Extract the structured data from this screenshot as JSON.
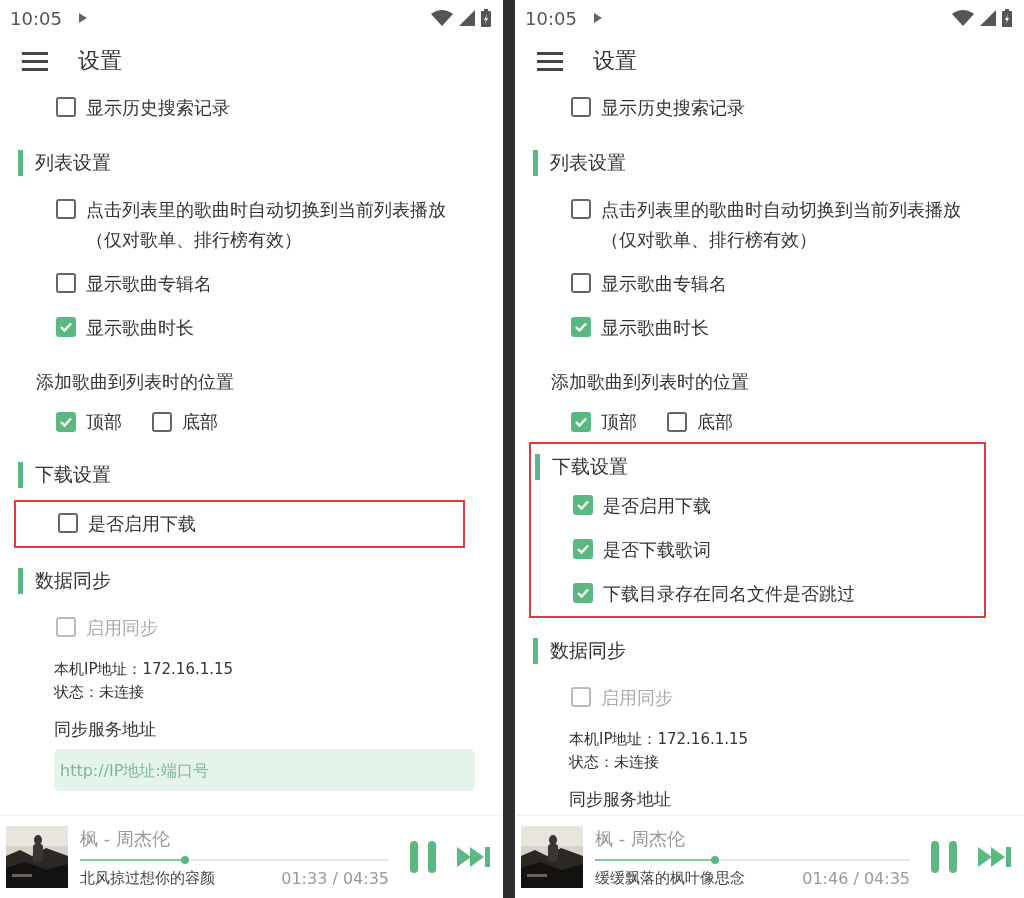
{
  "screens": [
    {
      "status_bar": {
        "time": "10:05"
      },
      "title": "设置",
      "blocks": [
        {
          "kind": "checkbox",
          "label": "显示历史搜索记录",
          "checked": false,
          "disabled": false
        },
        {
          "kind": "heading",
          "label": "列表设置"
        },
        {
          "kind": "checkbox",
          "label": "点击列表里的歌曲时自动切换到当前列表播放（仅对歌单、排行榜有效）",
          "checked": false,
          "disabled": false
        },
        {
          "kind": "checkbox",
          "label": "显示歌曲专辑名",
          "checked": false,
          "disabled": false
        },
        {
          "kind": "checkbox",
          "label": "显示歌曲时长",
          "checked": true,
          "disabled": false
        },
        {
          "kind": "subheading",
          "label": "添加歌曲到列表时的位置"
        },
        {
          "kind": "options",
          "options": [
            {
              "label": "顶部",
              "checked": true
            },
            {
              "label": "底部",
              "checked": false
            }
          ]
        },
        {
          "kind": "heading",
          "label": "下载设置"
        },
        {
          "kind": "group",
          "highlighted": true,
          "children": [
            {
              "kind": "checkbox",
              "label": "是否启用下载",
              "checked": false,
              "disabled": false
            }
          ]
        },
        {
          "kind": "heading",
          "label": "数据同步"
        },
        {
          "kind": "checkbox",
          "label": "启用同步",
          "checked": false,
          "disabled": true
        },
        {
          "kind": "info",
          "lines": [
            "本机IP地址：172.16.1.15",
            "状态：未连接"
          ]
        },
        {
          "kind": "label",
          "label": "同步服务地址"
        },
        {
          "kind": "input",
          "placeholder": "http://IP地址:端口号"
        }
      ],
      "player": {
        "title": "枫 - 周杰伦",
        "level": 0.34,
        "lyric": "北风掠过想你的容颜",
        "time": "01:33 / 04:35"
      }
    },
    {
      "status_bar": {
        "time": "10:05"
      },
      "title": "设置",
      "blocks": [
        {
          "kind": "checkbox",
          "label": "显示历史搜索记录",
          "checked": false,
          "disabled": false
        },
        {
          "kind": "heading",
          "label": "列表设置"
        },
        {
          "kind": "checkbox",
          "label": "点击列表里的歌曲时自动切换到当前列表播放（仅对歌单、排行榜有效）",
          "checked": false,
          "disabled": false
        },
        {
          "kind": "checkbox",
          "label": "显示歌曲专辑名",
          "checked": false,
          "disabled": false
        },
        {
          "kind": "checkbox",
          "label": "显示歌曲时长",
          "checked": true,
          "disabled": false
        },
        {
          "kind": "subheading",
          "label": "添加歌曲到列表时的位置"
        },
        {
          "kind": "options",
          "options": [
            {
              "label": "顶部",
              "checked": true
            },
            {
              "label": "底部",
              "checked": false
            }
          ]
        },
        {
          "kind": "group",
          "highlighted": true,
          "children": [
            {
              "kind": "heading",
              "label": "下载设置"
            },
            {
              "kind": "checkbox",
              "label": "是否启用下载",
              "checked": true,
              "disabled": false
            },
            {
              "kind": "checkbox",
              "label": "是否下载歌词",
              "checked": true,
              "disabled": false
            },
            {
              "kind": "checkbox",
              "label": "下载目录存在同名文件是否跳过",
              "checked": true,
              "disabled": false
            }
          ]
        },
        {
          "kind": "heading",
          "label": "数据同步"
        },
        {
          "kind": "checkbox",
          "label": "启用同步",
          "checked": false,
          "disabled": true
        },
        {
          "kind": "info",
          "lines": [
            "本机IP地址：172.16.1.15",
            "状态：未连接"
          ]
        },
        {
          "kind": "label",
          "label": "同步服务地址"
        }
      ],
      "player": {
        "title": "枫 - 周杰伦",
        "level": 0.38,
        "lyric": "缓缓飘落的枫叶像思念",
        "time": "01:46 / 04:35"
      }
    }
  ]
}
